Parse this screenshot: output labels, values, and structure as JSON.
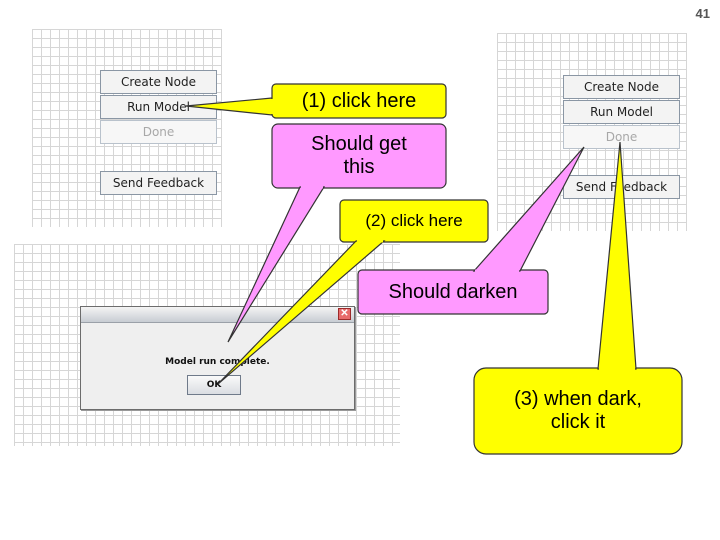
{
  "slide": {
    "number": "41"
  },
  "panel_left": {
    "buttons": {
      "create_node": "Create Node",
      "run_model": "Run Model",
      "done": "Done",
      "send_feedback": "Send Feedback"
    }
  },
  "panel_right": {
    "buttons": {
      "create_node": "Create Node",
      "run_model": "Run Model",
      "done": "Done",
      "send_feedback": "Send Feedback"
    }
  },
  "dialog": {
    "message": "Model run complete.",
    "ok_label": "OK",
    "close_glyph": "✕"
  },
  "callouts": {
    "click_here_1": "(1) click here",
    "should_get_line1": "Should get",
    "should_get_line2": "this",
    "click_here_2": "(2) click here",
    "should_darken": "Should darken",
    "when_dark_line1": "(3) when dark,",
    "when_dark_line2": "click it"
  },
  "colors": {
    "callout_yellow": "#ffff00",
    "callout_pink": "#ff99ff",
    "callout_border": "#333333"
  }
}
